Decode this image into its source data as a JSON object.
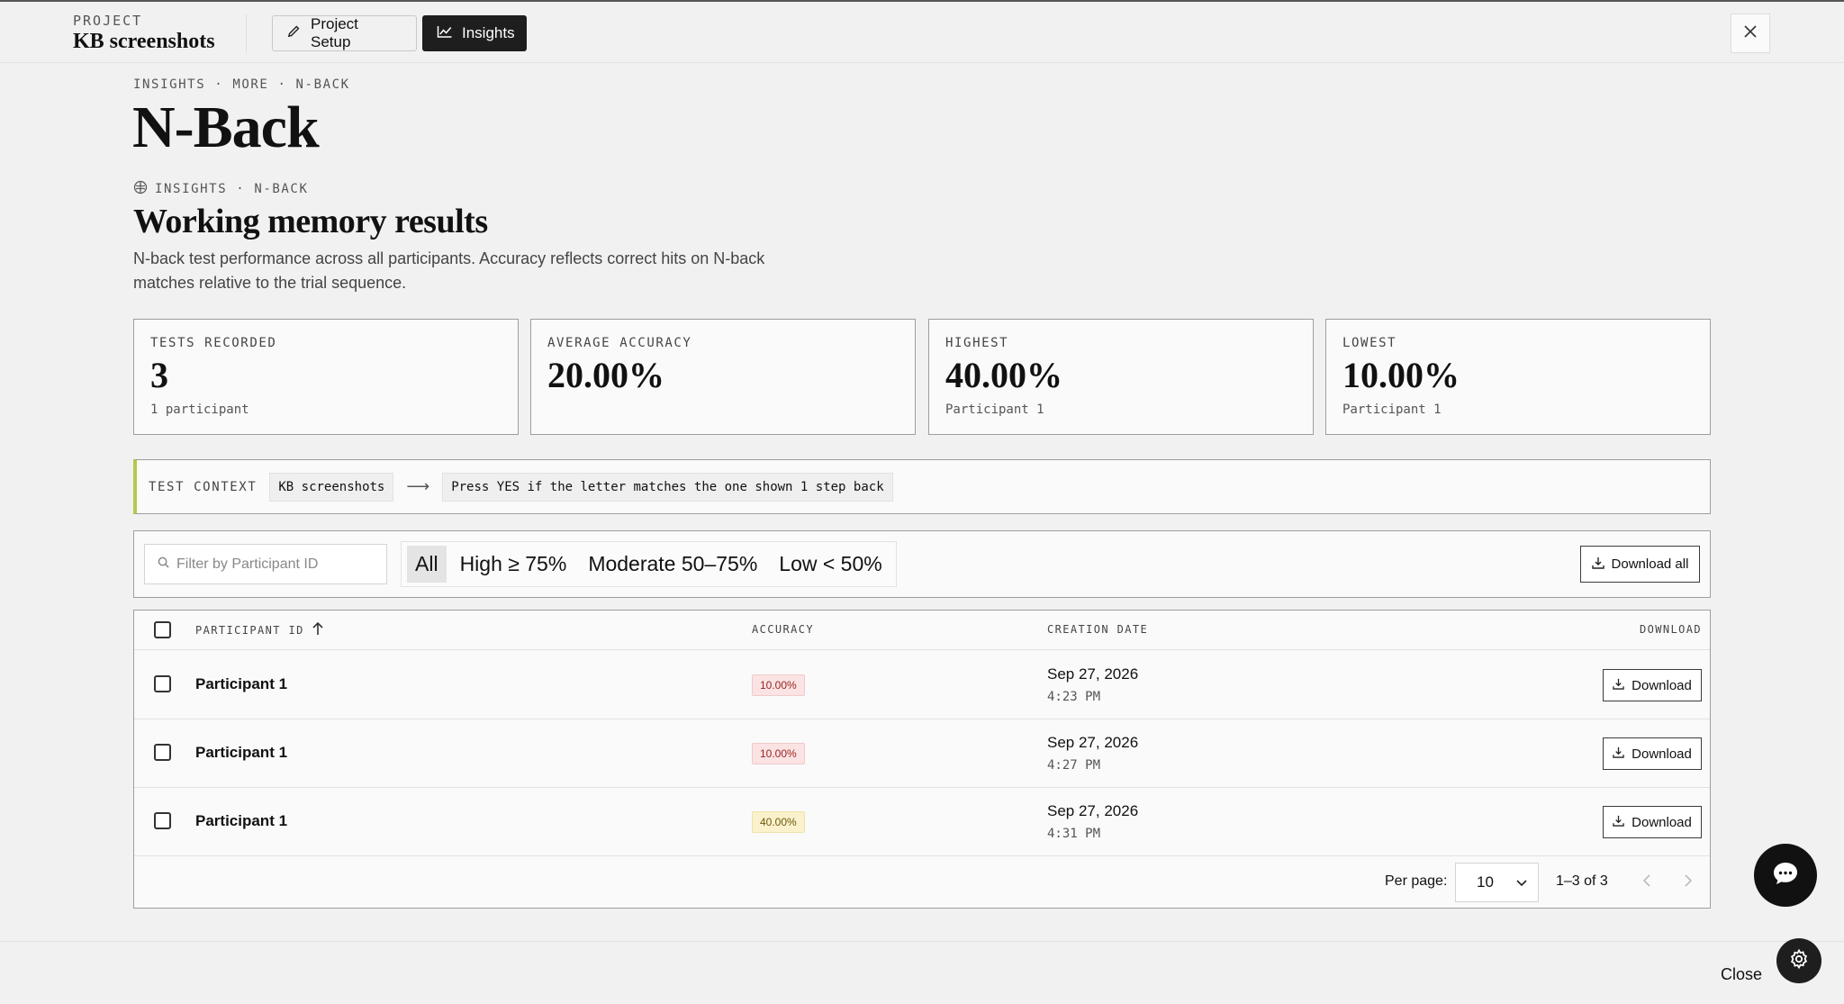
{
  "header": {
    "project_eyebrow": "PROJECT",
    "project_name": "KB screenshots",
    "tabs": [
      {
        "label": "Project Setup",
        "icon": "pencil-icon"
      },
      {
        "label": "Insights",
        "icon": "line-chart-icon"
      }
    ]
  },
  "page": {
    "breadcrumb": "INSIGHTS · MORE · N-BACK",
    "title": "N-Back",
    "section_eyebrow": "INSIGHTS · N-BACK",
    "section_title": "Working memory results",
    "section_desc": "N-back test performance across all participants. Accuracy reflects correct hits on N-back matches relative to the trial sequence."
  },
  "stats": [
    {
      "label": "TESTS RECORDED",
      "value": "3",
      "sub": "1 participant"
    },
    {
      "label": "AVERAGE ACCURACY",
      "value": "20.00%",
      "sub": ""
    },
    {
      "label": "HIGHEST",
      "value": "40.00%",
      "sub": "Participant 1"
    },
    {
      "label": "LOWEST",
      "value": "10.00%",
      "sub": "Participant 1"
    }
  ],
  "context": {
    "label": "TEST CONTEXT",
    "project": "KB screenshots",
    "arrow": "⟶",
    "instruction": "Press YES if the letter matches the one shown 1 step back"
  },
  "filters": {
    "search_placeholder": "Filter by Participant ID",
    "segments": [
      "All",
      "High ≥ 75%",
      "Moderate 50–75%",
      "Low < 50%"
    ],
    "active_segment": "All",
    "download_all": "Download all"
  },
  "table": {
    "columns": [
      "PARTICIPANT ID",
      "ACCURACY",
      "CREATION DATE",
      "DOWNLOAD"
    ],
    "rows": [
      {
        "participant": "Participant 1",
        "accuracy": "10.00%",
        "level": "low",
        "date": "Sep 27, 2026",
        "time": "4:23 PM",
        "download": "Download"
      },
      {
        "participant": "Participant 1",
        "accuracy": "10.00%",
        "level": "low",
        "date": "Sep 27, 2026",
        "time": "4:27 PM",
        "download": "Download"
      },
      {
        "participant": "Participant 1",
        "accuracy": "40.00%",
        "level": "mid",
        "date": "Sep 27, 2026",
        "time": "4:31 PM",
        "download": "Download"
      }
    ],
    "per_page_label": "Per page:",
    "per_page": "10",
    "range": "1–3 of 3"
  },
  "footer": {
    "close": "Close"
  },
  "colors": {
    "accent_bar": "#b5c94a",
    "low_badge": "#fbe3e3",
    "mid_badge": "#fbf1cc",
    "dark": "#1e1e1e"
  }
}
